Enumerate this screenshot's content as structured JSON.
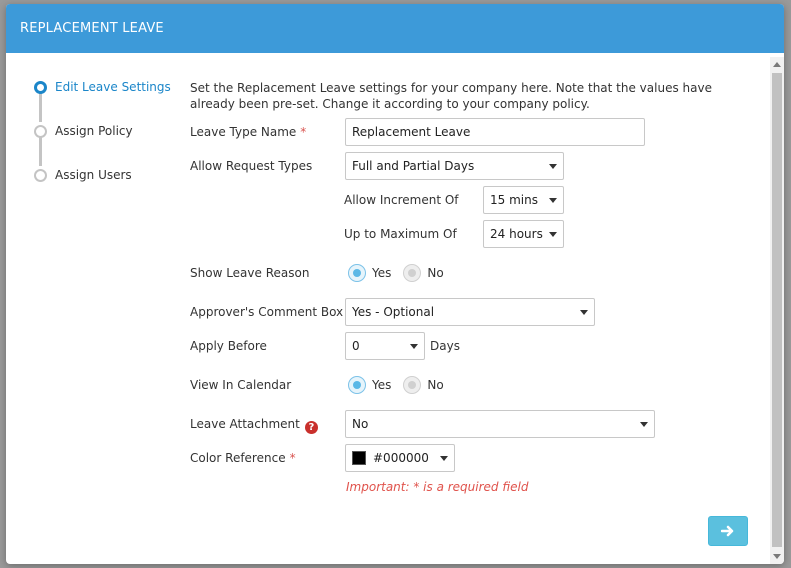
{
  "modal": {
    "title": "REPLACEMENT LEAVE"
  },
  "steps": [
    {
      "label": "Edit Leave Settings",
      "active": true
    },
    {
      "label": "Assign Policy",
      "active": false
    },
    {
      "label": "Assign Users",
      "active": false
    }
  ],
  "intro": "Set the Replacement Leave settings for your company here. Note that the values have already been pre-set. Change it according to your company policy.",
  "form": {
    "leave_type_name": {
      "label": "Leave Type Name",
      "required_mark": "*",
      "value": "Replacement Leave"
    },
    "allow_request_types": {
      "label": "Allow Request Types",
      "value": "Full and Partial Days"
    },
    "allow_increment": {
      "label": "Allow Increment Of",
      "value": "15 mins"
    },
    "up_to_max": {
      "label": "Up to Maximum Of",
      "value": "24 hours"
    },
    "show_leave_reason": {
      "label": "Show Leave Reason",
      "yes": "Yes",
      "no": "No",
      "selected": "Yes"
    },
    "approver_comment": {
      "label": "Approver's Comment Box",
      "value": "Yes - Optional"
    },
    "apply_before": {
      "label": "Apply Before",
      "value": "0",
      "unit": "Days"
    },
    "view_in_calendar": {
      "label": "View In Calendar",
      "yes": "Yes",
      "no": "No",
      "selected": "Yes"
    },
    "leave_attachment": {
      "label": "Leave Attachment",
      "help": "?",
      "value": "No"
    },
    "color_reference": {
      "label": "Color Reference",
      "required_mark": "*",
      "value": "#000000",
      "swatch": "#000000"
    }
  },
  "important_note": "Important: * is a required field",
  "buttons": {
    "next_icon": "arrow-right-icon"
  },
  "colors": {
    "header": "#3d9ad9",
    "accent": "#1b86c9",
    "next_button": "#5bc0de",
    "required": "#d9534f"
  }
}
